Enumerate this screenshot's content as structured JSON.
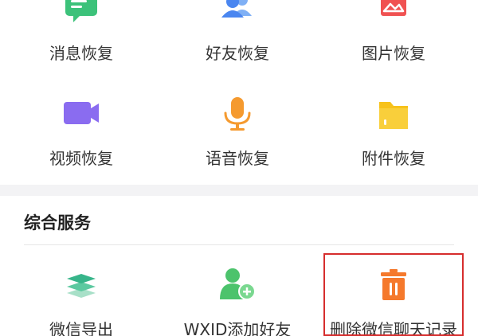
{
  "recovery": {
    "items": [
      {
        "label": "消息恢复",
        "icon": "message-icon"
      },
      {
        "label": "好友恢复",
        "icon": "friends-icon"
      },
      {
        "label": "图片恢复",
        "icon": "image-icon"
      },
      {
        "label": "视频恢复",
        "icon": "video-icon"
      },
      {
        "label": "语音恢复",
        "icon": "microphone-icon"
      },
      {
        "label": "附件恢复",
        "icon": "folder-icon"
      }
    ]
  },
  "services": {
    "title": "综合服务",
    "items": [
      {
        "label": "微信导出",
        "icon": "layers-icon"
      },
      {
        "label": "WXID添加好友",
        "icon": "add-friend-icon"
      },
      {
        "label": "删除微信聊天记录",
        "icon": "trash-icon"
      }
    ]
  },
  "colors": {
    "message": "#3cc27a",
    "friends": "#4a86f0",
    "image": "#f05252",
    "video": "#8a6cf0",
    "microphone": "#f59a2f",
    "folder": "#f7c21b",
    "layers": "#37b58a",
    "add_friend": "#4cc36c",
    "trash": "#f5792c",
    "highlight": "#d62d2d"
  }
}
